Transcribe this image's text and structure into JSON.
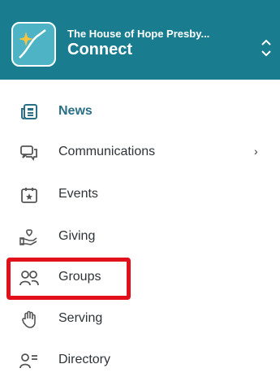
{
  "header": {
    "org_name": "The House of Hope Presby...",
    "app_name": "Connect",
    "background": "#1a7d8f",
    "logo_icon": "sparkle-chart-icon",
    "switcher_icon": "up-down-chevron-icon"
  },
  "nav": {
    "items": [
      {
        "label": "News",
        "icon": "news-icon",
        "active": true
      },
      {
        "label": "Communications",
        "icon": "chat-icon",
        "has_submenu": true,
        "submenu_indicator": "›"
      },
      {
        "label": "Events",
        "icon": "calendar-star-icon"
      },
      {
        "label": "Giving",
        "icon": "hand-heart-icon"
      },
      {
        "label": "Groups",
        "icon": "people-icon",
        "highlighted": true
      },
      {
        "label": "Serving",
        "icon": "raised-hand-icon"
      },
      {
        "label": "Directory",
        "icon": "person-list-icon"
      }
    ],
    "active_color": "#2a6f86",
    "highlight_color": "#e2101a"
  }
}
